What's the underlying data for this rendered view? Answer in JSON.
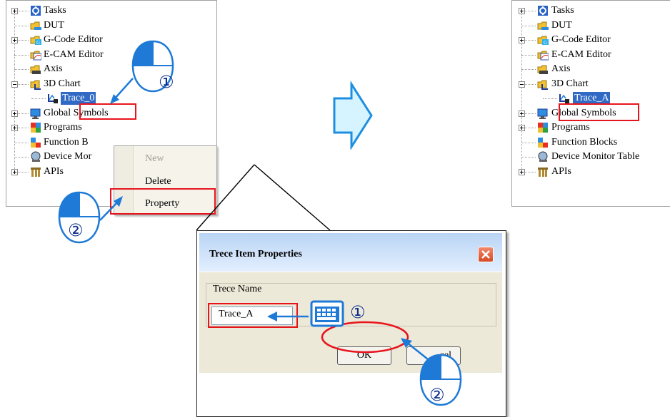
{
  "tree_left": {
    "items": [
      {
        "label": "Tasks",
        "icon": "tasks-icon",
        "expander": "plus"
      },
      {
        "label": "DUT",
        "icon": "dut-icon",
        "expander": "none"
      },
      {
        "label": "G-Code Editor",
        "icon": "gcode-editor-icon",
        "expander": "plus"
      },
      {
        "label": "E-CAM Editor",
        "icon": "ecam-editor-icon",
        "expander": "none"
      },
      {
        "label": "Axis",
        "icon": "axis-icon",
        "expander": "none"
      },
      {
        "label": "3D Chart",
        "icon": "chart-3d-icon",
        "expander": "minus"
      },
      {
        "label": "Trace_0",
        "icon": "trace-icon",
        "expander": "none",
        "selected": true,
        "child": true
      },
      {
        "label": "Global Symbols",
        "icon": "global-symbols-icon",
        "expander": "plus"
      },
      {
        "label": "Programs",
        "icon": "programs-icon",
        "expander": "plus"
      },
      {
        "label": "Function B",
        "icon": "function-blocks-icon",
        "expander": "none"
      },
      {
        "label": "Device Mor",
        "icon": "device-monitor-icon",
        "expander": "none"
      },
      {
        "label": "APIs",
        "icon": "apis-icon",
        "expander": "plus"
      }
    ]
  },
  "tree_right": {
    "items": [
      {
        "label": "Tasks",
        "icon": "tasks-icon",
        "expander": "plus"
      },
      {
        "label": "DUT",
        "icon": "dut-icon",
        "expander": "none"
      },
      {
        "label": "G-Code Editor",
        "icon": "gcode-editor-icon",
        "expander": "plus"
      },
      {
        "label": "E-CAM Editor",
        "icon": "ecam-editor-icon",
        "expander": "none"
      },
      {
        "label": "Axis",
        "icon": "axis-icon",
        "expander": "none"
      },
      {
        "label": "3D Chart",
        "icon": "chart-3d-icon",
        "expander": "minus"
      },
      {
        "label": "Trace_A",
        "icon": "trace-icon",
        "expander": "none",
        "selected": true,
        "child": true
      },
      {
        "label": "Global Symbols",
        "icon": "global-symbols-icon",
        "expander": "plus"
      },
      {
        "label": "Programs",
        "icon": "programs-icon",
        "expander": "plus"
      },
      {
        "label": "Function Blocks",
        "icon": "function-blocks-icon",
        "expander": "none"
      },
      {
        "label": "Device Monitor Table",
        "icon": "device-monitor-icon",
        "expander": "none"
      },
      {
        "label": "APIs",
        "icon": "apis-icon",
        "expander": "plus"
      }
    ]
  },
  "context_menu": {
    "items": [
      {
        "label": "New",
        "disabled": true
      },
      {
        "label": "Delete",
        "disabled": false
      },
      {
        "label": "Property",
        "disabled": false,
        "highlighted": true
      }
    ]
  },
  "dialog": {
    "title": "Trece Item Properties",
    "field_label": "Trece Name",
    "field_value": "Trace_A",
    "ok_label": "OK",
    "cancel_label": "cel"
  },
  "step_markers": {
    "one": "①",
    "two": "②"
  },
  "colors": {
    "highlight_red": "#e8141c",
    "selection_blue": "#316ac5",
    "annotation_blue": "#1e7ad6",
    "arrow_fill": "#d6f4ff"
  }
}
